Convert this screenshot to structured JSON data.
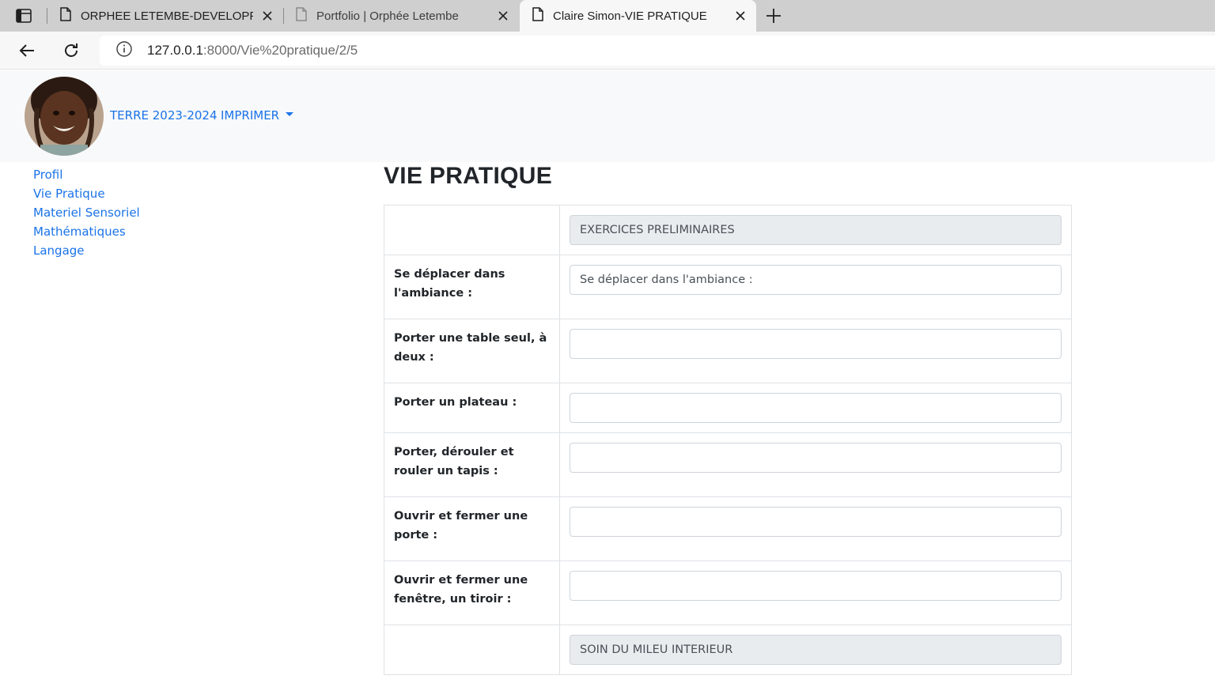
{
  "browser": {
    "tabs": [
      {
        "title": "ORPHEE LETEMBE-DEVELOPPEUR"
      },
      {
        "title": "Portfolio | Orphée Letembe"
      },
      {
        "title": "Claire Simon-VIE PRATIQUE"
      }
    ],
    "url_host": "127.0.0.1",
    "url_rest": ":8000/Vie%20pratique/2/5"
  },
  "navbar": {
    "year_link": "TERRE 2023-2024",
    "print_menu": "IMPRIMER"
  },
  "sidebar": {
    "items": [
      {
        "label": "Profil"
      },
      {
        "label": "Vie Pratique"
      },
      {
        "label": "Materiel Sensoriel"
      },
      {
        "label": "Mathématiques"
      },
      {
        "label": "Langage"
      }
    ]
  },
  "main": {
    "title": "VIE PRATIQUE",
    "rows": [
      {
        "label": "",
        "value": "EXERCICES PRELIMINAIRES",
        "section": true
      },
      {
        "label": "Se déplacer dans l'ambiance :",
        "placeholder": "Se déplacer dans l'ambiance :"
      },
      {
        "label": "Porter une table seul, à deux :",
        "placeholder": ""
      },
      {
        "label": "Porter un plateau :",
        "placeholder": ""
      },
      {
        "label": "Porter, dérouler et rouler un tapis :",
        "placeholder": ""
      },
      {
        "label": "Ouvrir et fermer une porte :",
        "placeholder": ""
      },
      {
        "label": "Ouvrir et fermer une fenêtre, un tiroir :",
        "placeholder": ""
      },
      {
        "label": "",
        "value": "SOIN DU MILEU INTERIEUR",
        "section": true
      }
    ]
  }
}
